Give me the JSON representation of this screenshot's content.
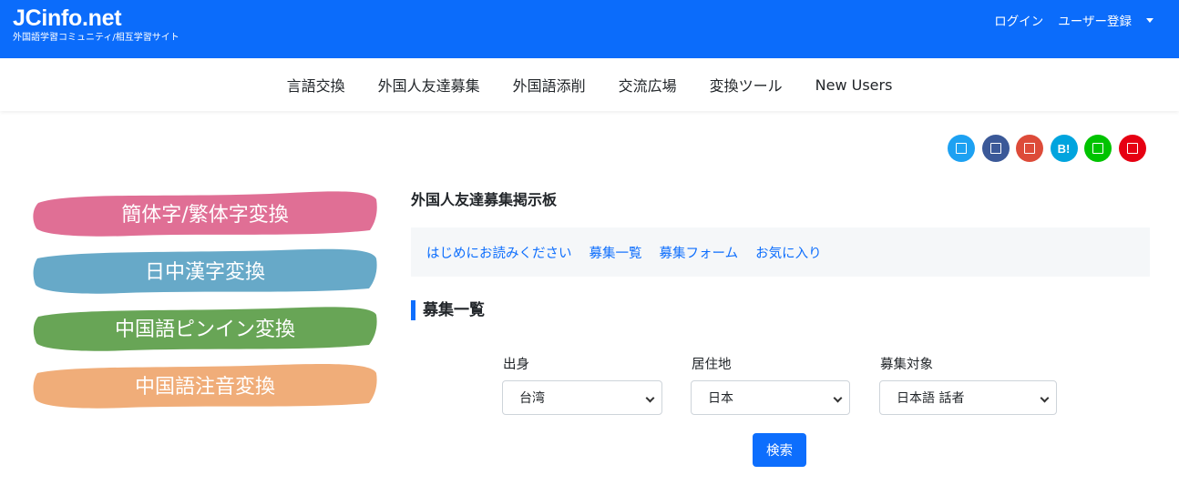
{
  "header": {
    "brand_title": "JCinfo.net",
    "brand_subtitle": "外国語学習コミュニティ/相互学習サイト",
    "login": "ログイン",
    "register": "ユーザー登録"
  },
  "nav": [
    "言語交換",
    "外国人友達募集",
    "外国語添削",
    "交流広場",
    "変換ツール",
    "New Users"
  ],
  "social": {
    "colors": [
      "#1da1f2",
      "#3b5998",
      "#dd4b39",
      "#00a4de",
      "#00c300",
      "#e60012"
    ],
    "icons": [
      "twitter-icon",
      "facebook-icon",
      "googleplus-icon",
      "hatena-icon",
      "line-icon",
      "pocket-icon"
    ],
    "hatena_label": "B!"
  },
  "tools": [
    {
      "label": "簡体字/繁体字変換",
      "color": "#e06f95"
    },
    {
      "label": "日中漢字変換",
      "color": "#67a9c8"
    },
    {
      "label": "中国語ピンイン変換",
      "color": "#68a556"
    },
    {
      "label": "中国語注音変換",
      "color": "#f0ad79"
    }
  ],
  "main": {
    "title": "外国人友達募集掲示板",
    "tabs": [
      "はじめにお読みください",
      "募集一覧",
      "募集フォーム",
      "お気に入り"
    ],
    "list_title": "募集一覧",
    "filters": [
      {
        "label": "出身",
        "value": "台湾"
      },
      {
        "label": "居住地",
        "value": "日本"
      },
      {
        "label": "募集対象",
        "value": "日本語 話者"
      }
    ],
    "search_label": "検索"
  }
}
